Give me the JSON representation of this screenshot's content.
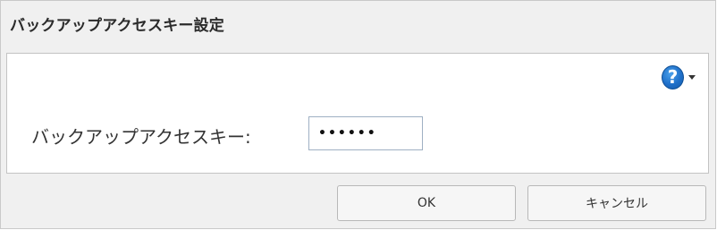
{
  "dialog": {
    "title": "バックアップアクセスキー設定"
  },
  "form": {
    "label": "バックアップアクセスキー:",
    "value": "••••••"
  },
  "help": {
    "icon": "help-question-icon",
    "symbol": "?"
  },
  "buttons": {
    "ok": "OK",
    "cancel": "キャンセル"
  }
}
